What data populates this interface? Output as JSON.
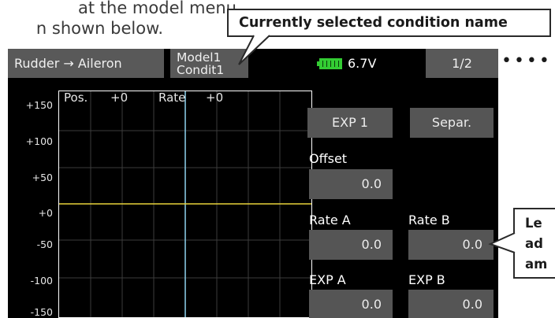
{
  "document": {
    "line1": "at the model menu",
    "line2": "n shown below."
  },
  "callouts": {
    "selected_condition": "Currently selected condition name",
    "side_line1": "Le",
    "side_line2": "ad",
    "side_line3": "am"
  },
  "screen": {
    "function_name": "Rudder → Aileron",
    "model_name": "Model1",
    "condition_name": "Condit1",
    "battery_voltage": "6.7V",
    "page_indicator": "1/2",
    "graph": {
      "y_ticks": [
        "+150",
        "+100",
        "+50",
        "+0",
        "-50",
        "-100",
        "-150"
      ],
      "pos_label": "Pos.",
      "pos_value": "+0",
      "rate_label": "Rate",
      "rate_value": "+0"
    },
    "buttons": {
      "exp1": "EXP 1",
      "separ": "Separ."
    },
    "offset": {
      "label": "Offset",
      "value": "0.0"
    },
    "rate_a": {
      "label": "Rate A",
      "value": "0.0"
    },
    "rate_b": {
      "label": "Rate B",
      "value": "0.0"
    },
    "exp_a": {
      "label": "EXP A",
      "value": "0.0"
    },
    "exp_b": {
      "label": "EXP B",
      "value": "0.0"
    }
  },
  "colors": {
    "screen_bg": "#000000",
    "header_bg": "#595959",
    "button_bg": "#555555",
    "grid": "#3c3c3c",
    "curve": "#e8d23a",
    "position_line": "#8fd4f0",
    "battery": "#33cc33"
  }
}
